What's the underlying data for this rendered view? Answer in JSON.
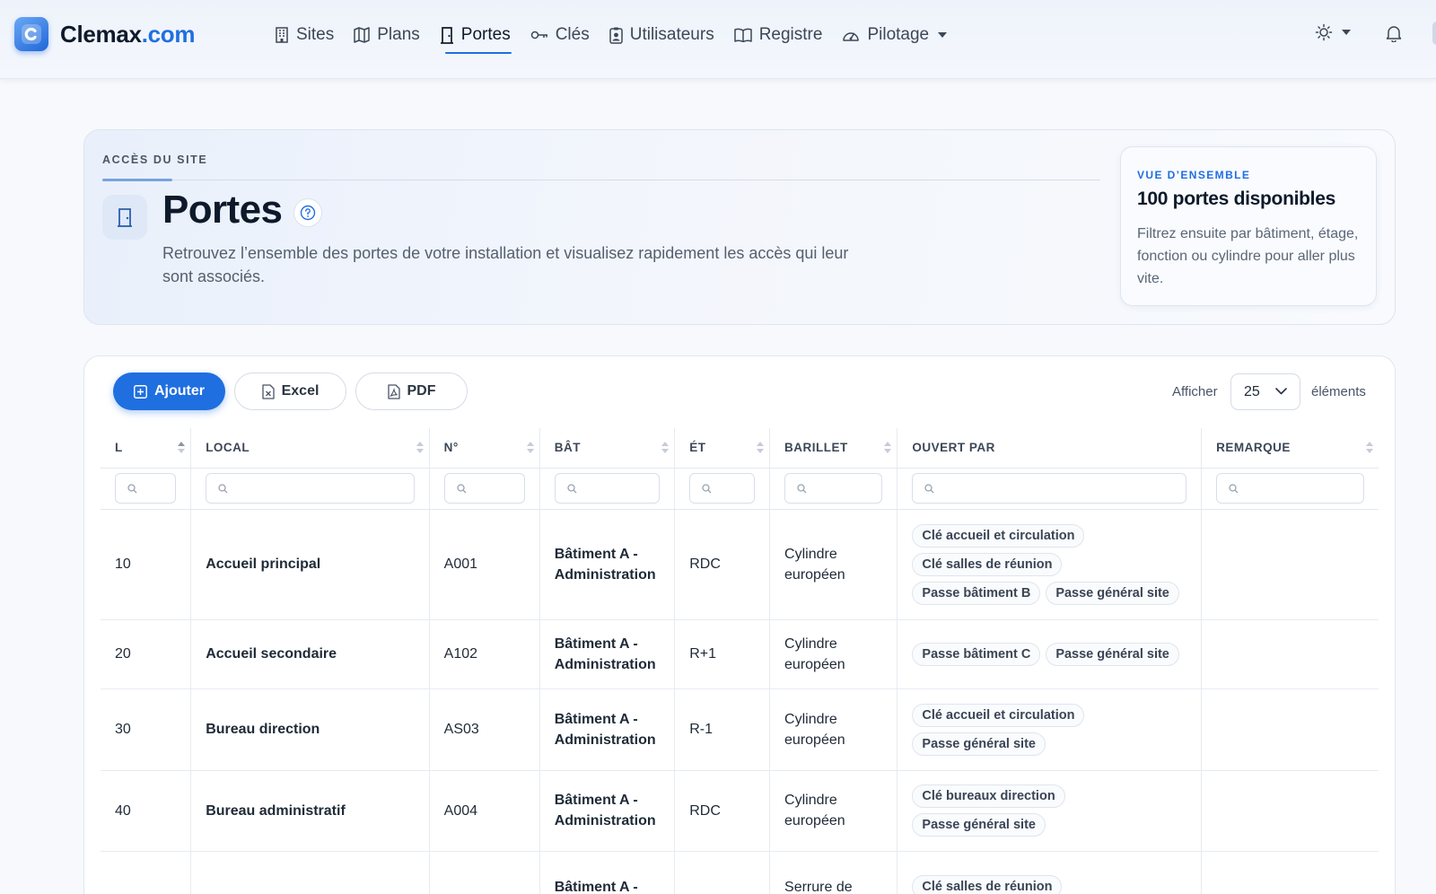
{
  "brand": {
    "name": "Clemax",
    "tld": ".com"
  },
  "nav": [
    {
      "label": "Sites",
      "icon": "building-icon"
    },
    {
      "label": "Plans",
      "icon": "map-icon"
    },
    {
      "label": "Portes",
      "icon": "door-icon",
      "active": true
    },
    {
      "label": "Clés",
      "icon": "key-icon"
    },
    {
      "label": "Utilisateurs",
      "icon": "badge-icon"
    },
    {
      "label": "Registre",
      "icon": "book-icon"
    },
    {
      "label": "Pilotage",
      "icon": "gauge-icon",
      "dropdown": true
    }
  ],
  "hero": {
    "eyebrow": "ACCÈS DU SITE",
    "title": "Portes",
    "description": "Retrouvez l’ensemble des portes de votre installation et visualisez rapidement les accès qui leur sont associés."
  },
  "overview": {
    "eyebrow": "VUE D’ENSEMBLE",
    "title": "100 portes disponibles",
    "description": "Filtrez ensuite par bâtiment, étage, fonction ou cylindre pour aller plus vite."
  },
  "toolbar": {
    "add_label": "Ajouter",
    "excel_label": "Excel",
    "pdf_label": "PDF",
    "show_label": "Afficher",
    "page_size": "25",
    "elements_label": "éléments"
  },
  "table": {
    "columns": [
      "L",
      "LOCAL",
      "N°",
      "BÂT",
      "ÉT",
      "BARILLET",
      "OUVERT PAR",
      "REMARQUE"
    ],
    "rows": [
      {
        "l": "10",
        "local": "Accueil principal",
        "num": "A001",
        "bat": "Bâtiment A - Administration",
        "et": "RDC",
        "barillet": "Cylindre européen",
        "ouvert_par": [
          "Clé accueil et circulation",
          "Clé salles de réunion",
          "Passe bâtiment B",
          "Passe général site"
        ],
        "remarque": ""
      },
      {
        "l": "20",
        "local": "Accueil secondaire",
        "num": "A102",
        "bat": "Bâtiment A - Administration",
        "et": "R+1",
        "barillet": "Cylindre européen",
        "ouvert_par": [
          "Passe bâtiment C",
          "Passe général site"
        ],
        "remarque": ""
      },
      {
        "l": "30",
        "local": "Bureau direction",
        "num": "AS03",
        "bat": "Bâtiment A - Administration",
        "et": "R-1",
        "barillet": "Cylindre européen",
        "ouvert_par": [
          "Clé accueil et circulation",
          "Passe général site"
        ],
        "remarque": ""
      },
      {
        "l": "40",
        "local": "Bureau administratif",
        "num": "A004",
        "bat": "Bâtiment A - Administration",
        "et": "RDC",
        "barillet": "Cylindre européen",
        "ouvert_par": [
          "Clé bureaux direction",
          "Passe général site"
        ],
        "remarque": ""
      },
      {
        "l": "",
        "local": "",
        "num": "",
        "bat": "Bâtiment A -",
        "et": "",
        "barillet": "Serrure de",
        "ouvert_par": [
          "Clé salles de réunion"
        ],
        "remarque": ""
      }
    ]
  },
  "colors": {
    "accent": "#1f6fe0",
    "building_text": "#1a4f9c"
  }
}
